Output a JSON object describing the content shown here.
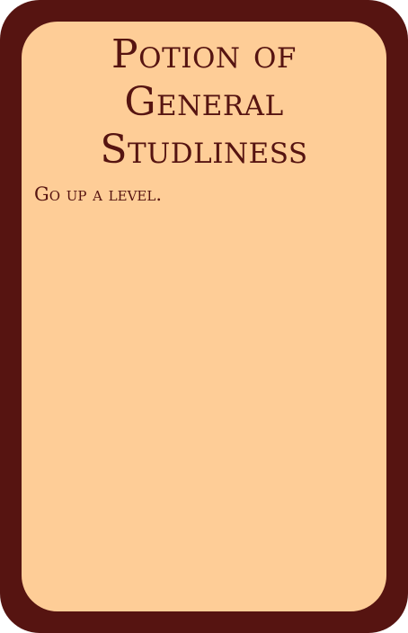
{
  "card": {
    "title_line1": "Potion of",
    "title_line2": "General",
    "title_line3": "Studliness",
    "text": "Go up a level.",
    "colors": {
      "frame": "#561411",
      "face": "#fecd97",
      "ink": "#561411"
    }
  }
}
